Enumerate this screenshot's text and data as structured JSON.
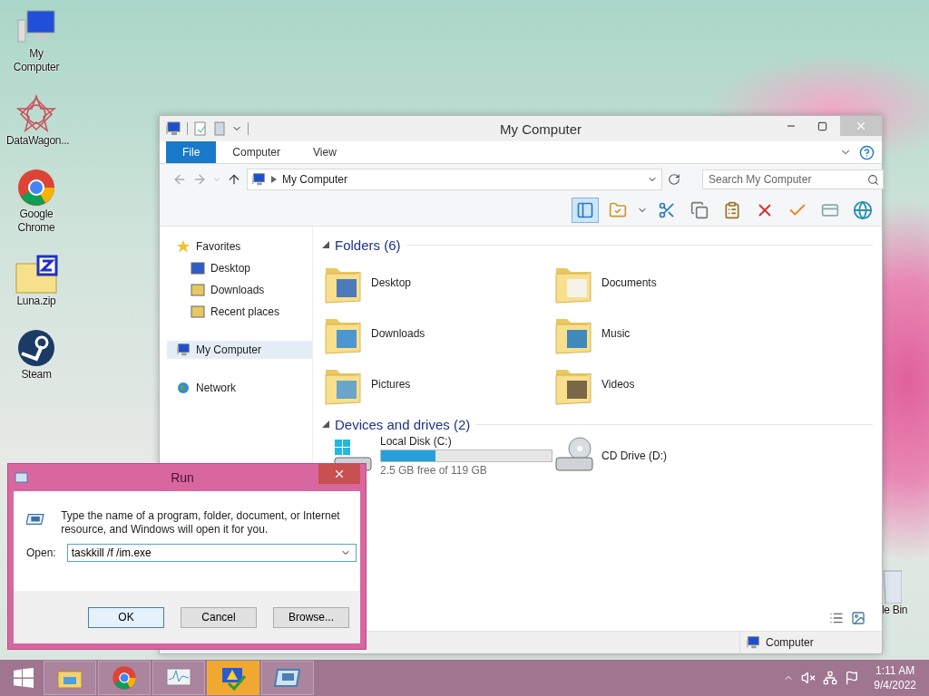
{
  "desktop_icons": [
    {
      "label": "My Computer"
    },
    {
      "label": "DataWagon..."
    },
    {
      "label": "Google Chrome"
    },
    {
      "label": "Luna.zip"
    },
    {
      "label": "Steam"
    }
  ],
  "recycle_bin": {
    "label": "le Bin"
  },
  "explorer": {
    "title": "My Computer",
    "ribbon_tabs": [
      {
        "label": "File",
        "selected": true
      },
      {
        "label": "Computer",
        "selected": false
      },
      {
        "label": "View",
        "selected": false
      }
    ],
    "address": "My Computer",
    "search": {
      "placeholder": "Search My Computer"
    },
    "nav": [
      {
        "label": "Favorites",
        "selected": false,
        "children": [
          {
            "label": "Desktop",
            "selected": false
          },
          {
            "label": "Downloads",
            "selected": false
          },
          {
            "label": "Recent places",
            "selected": false
          }
        ]
      },
      {
        "label": "My Computer",
        "selected": true
      },
      {
        "label": "Network",
        "selected": false
      }
    ],
    "folders_heading": "Folders (6)",
    "folders": [
      {
        "label": "Desktop"
      },
      {
        "label": "Documents"
      },
      {
        "label": "Downloads"
      },
      {
        "label": "Music"
      },
      {
        "label": "Pictures"
      },
      {
        "label": "Videos"
      }
    ],
    "drives_heading": "Devices and drives (2)",
    "drives": [
      {
        "kind": "disk",
        "label": "Local Disk (C:)",
        "level": 0.32,
        "free": "2.5 GB free of 119 GB"
      },
      {
        "kind": "cd",
        "label": "CD Drive (D:)"
      }
    ],
    "status_bar": {
      "item": "Computer"
    }
  },
  "run_dialog": {
    "title": "Run",
    "description": "Type the name of a program, folder, document, or Internet resource, and Windows will open it for you.",
    "open_label": "Open:",
    "value": "taskkill /f /im.exe",
    "buttons": [
      {
        "label": "OK",
        "default": true
      },
      {
        "label": "Cancel",
        "default": false
      },
      {
        "label": "Browse...",
        "default": false
      }
    ]
  },
  "taskbar": {
    "apps": [
      {
        "active": false
      },
      {
        "active": false
      },
      {
        "active": false
      },
      {
        "active": true
      },
      {
        "active": false
      }
    ],
    "clock": {
      "time": "1:11 AM",
      "date": "9/4/2022"
    }
  }
}
